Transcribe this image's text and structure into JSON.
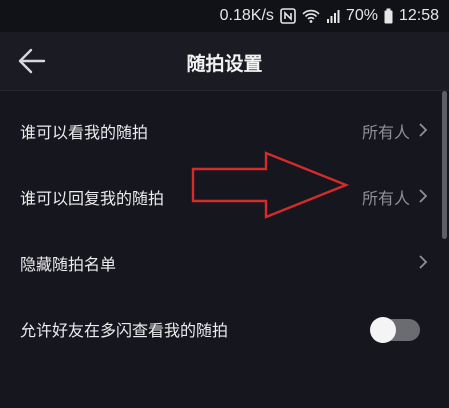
{
  "status_bar": {
    "speed": "0.18K/s",
    "battery": "70%",
    "time": "12:58"
  },
  "header": {
    "title": "随拍设置"
  },
  "settings": [
    {
      "label": "谁可以看我的随拍",
      "value": "所有人"
    },
    {
      "label": "谁可以回复我的随拍",
      "value": "所有人"
    },
    {
      "label": "隐藏随拍名单"
    },
    {
      "label": "允许好友在多闪查看我的随拍",
      "toggle_on": false
    }
  ],
  "colors": {
    "background": "#16161e",
    "annotation": "#d62b2b"
  }
}
